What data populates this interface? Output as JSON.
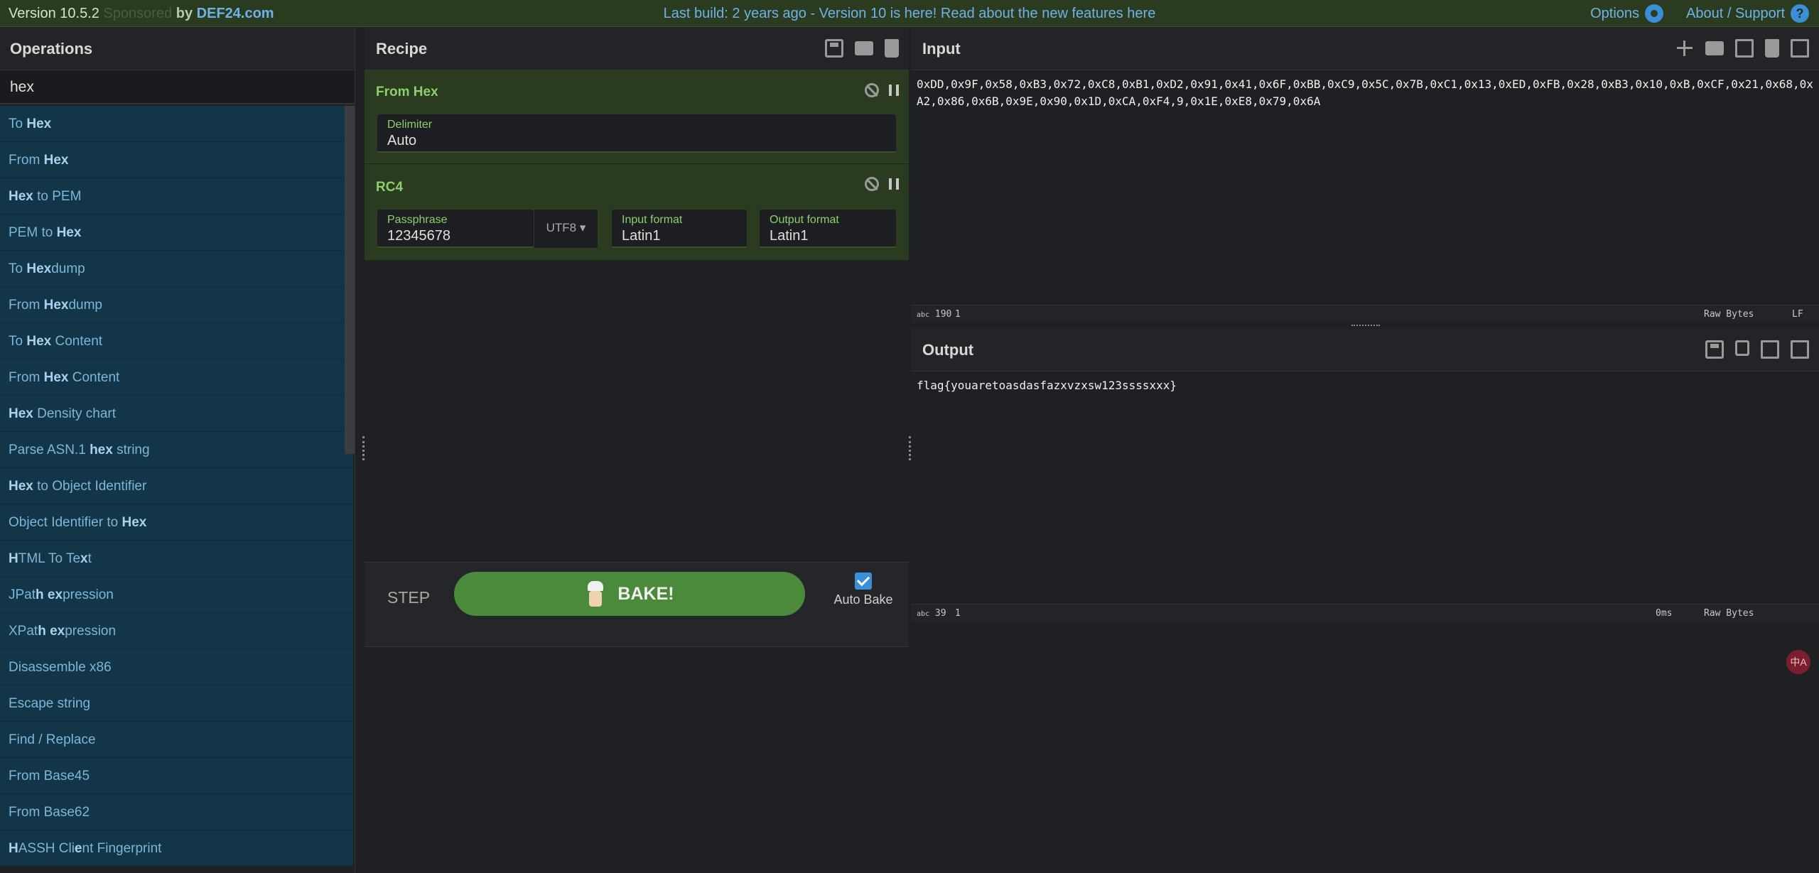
{
  "banner": {
    "version": "Version 10.5.2",
    "sponsor_faded": "Sponsored",
    "by": "by",
    "brand": "DEF24.com",
    "notice": "Last build: 2 years ago - Version 10 is here! Read about the new features here",
    "options": "Options",
    "about": "About / Support",
    "help_glyph": "?"
  },
  "operations": {
    "title": "Operations",
    "search_value": "hex",
    "items": [
      {
        "pre": "To ",
        "hl": "Hex",
        "post": ""
      },
      {
        "pre": "From ",
        "hl": "Hex",
        "post": ""
      },
      {
        "pre": "",
        "hl": "Hex",
        "post": " to PEM"
      },
      {
        "pre": "PEM to ",
        "hl": "Hex",
        "post": ""
      },
      {
        "pre": "To ",
        "hl": "Hex",
        "post": "dump"
      },
      {
        "pre": "From ",
        "hl": "Hex",
        "post": "dump"
      },
      {
        "pre": "To ",
        "hl": "Hex",
        "post": " Content"
      },
      {
        "pre": "From ",
        "hl": "Hex",
        "post": " Content"
      },
      {
        "pre": "",
        "hl": "Hex",
        "post": " Density chart"
      },
      {
        "pre": "Parse ASN.1 ",
        "hl": "hex",
        "post": " string"
      },
      {
        "pre": "",
        "hl": "Hex",
        "post": " to Object Identifier"
      },
      {
        "pre": "Object Identifier to ",
        "hl": "Hex",
        "post": ""
      },
      {
        "pre": "",
        "hl": "H",
        "post": "TML To Te",
        "hl2": "x",
        "post2": "t"
      },
      {
        "pre": "JPat",
        "hl": "h",
        "post": " ",
        "hl2": "ex",
        "post2": "pression"
      },
      {
        "pre": "XPat",
        "hl": "h",
        "post": " ",
        "hl2": "ex",
        "post2": "pression"
      },
      {
        "pre": "Disassemble x86",
        "hl": "",
        "post": ""
      },
      {
        "pre": "Escape string",
        "hl": "",
        "post": ""
      },
      {
        "pre": "Find / Replace",
        "hl": "",
        "post": ""
      },
      {
        "pre": "From Base45",
        "hl": "",
        "post": ""
      },
      {
        "pre": "From Base62",
        "hl": "",
        "post": ""
      },
      {
        "pre": "",
        "hl": "H",
        "post": "ASSH Cli",
        "hl2": "e",
        "post2": "nt Fingerprint"
      }
    ]
  },
  "recipe": {
    "title": "Recipe",
    "from_hex": {
      "title": "From Hex",
      "delimiter_label": "Delimiter",
      "delimiter_value": "Auto"
    },
    "rc4": {
      "title": "RC4",
      "passphrase_label": "Passphrase",
      "passphrase_value": "12345678",
      "encoding": "UTF8 ▾",
      "input_format_label": "Input format",
      "input_format_value": "Latin1",
      "output_format_label": "Output format",
      "output_format_value": "Latin1"
    },
    "step": "STEP",
    "bake": "BAKE!",
    "auto_bake": "Auto Bake"
  },
  "input": {
    "title": "Input",
    "text": "0xDD,0x9F,0x58,0xB3,0x72,0xC8,0xB1,0xD2,0x91,0x41,0x6F,0xBB,0xC9,0x5C,0x7B,0xC1,0x13,0xED,0xFB,0x28,0xB3,0x10,0xB,0xCF,0x21,0x68,0xA2,0x86,0x6B,0x9E,0x90,0x1D,0xCA,0xF4,9,0x1E,0xE8,0x79,0x6A",
    "length_label": "abc",
    "length": "190",
    "lines": "1",
    "raw_bytes": "Raw Bytes",
    "eol": "LF"
  },
  "output": {
    "title": "Output",
    "text": "flag{youaretoasdasfazxvzxsw123ssssxxx}",
    "length_label": "abc",
    "length": "39",
    "lines": "1",
    "time": "0ms",
    "raw_bytes": "Raw Bytes",
    "lang_glyph": "中A"
  }
}
